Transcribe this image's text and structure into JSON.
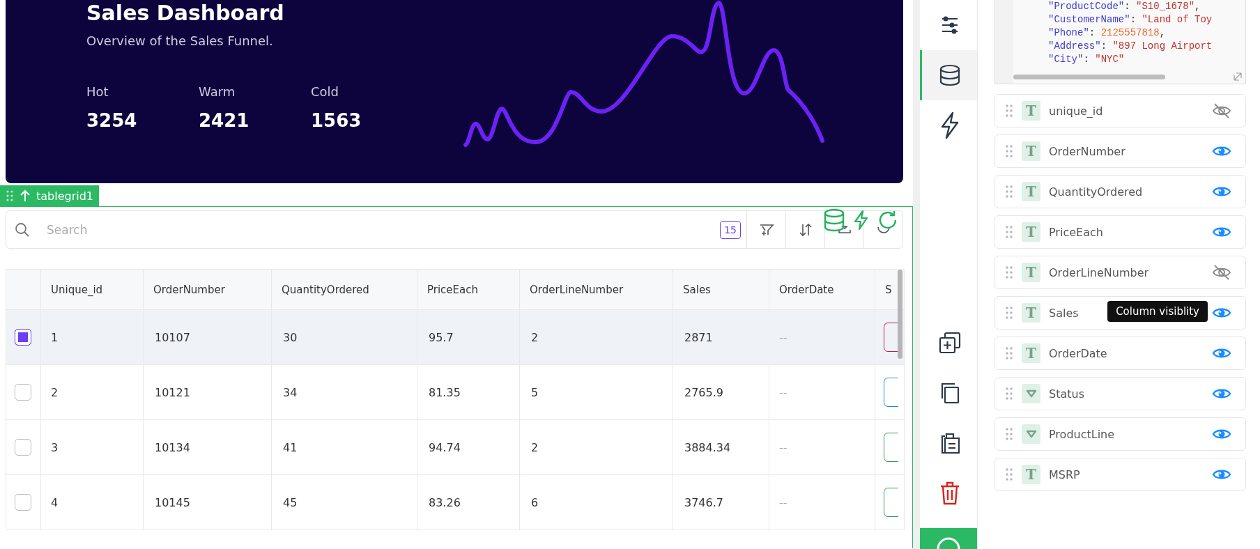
{
  "dashboard": {
    "title": "Sales Dashboard",
    "subtitle": "Overview of the Sales Funnel.",
    "stats": [
      {
        "label": "Hot",
        "value": "3254"
      },
      {
        "label": "Warm",
        "value": "2421"
      },
      {
        "label": "Cold",
        "value": "1563"
      }
    ]
  },
  "widget_tag": {
    "label": "tablegrid1"
  },
  "toolbar": {
    "search": {
      "placeholder": "Search"
    },
    "page_size": "15"
  },
  "table": {
    "columns": [
      "Unique_id",
      "OrderNumber",
      "QuantityOrdered",
      "PriceEach",
      "OrderLineNumber",
      "Sales",
      "OrderDate",
      "S"
    ],
    "rows": [
      {
        "selected": true,
        "cells": [
          "1",
          "10107",
          "30",
          "95.7",
          "2",
          "2871",
          "--"
        ],
        "color": "#c2185b"
      },
      {
        "selected": false,
        "cells": [
          "2",
          "10121",
          "34",
          "81.35",
          "5",
          "2765.9",
          "--"
        ],
        "color": "#1e88e5"
      },
      {
        "selected": false,
        "cells": [
          "3",
          "10134",
          "41",
          "94.74",
          "2",
          "3884.34",
          "--"
        ],
        "color": "#2e9e4f"
      },
      {
        "selected": false,
        "cells": [
          "4",
          "10145",
          "45",
          "83.26",
          "6",
          "3746.7",
          "--"
        ],
        "color": "#2e9e4f"
      }
    ]
  },
  "rail": [
    {
      "kind": "sliders",
      "selected": false
    },
    {
      "kind": "database",
      "selected": true
    },
    {
      "kind": "bolt",
      "selected": false
    },
    {
      "kind": "add-copy",
      "selected": false
    },
    {
      "kind": "copy",
      "selected": false
    },
    {
      "kind": "clipboard",
      "selected": false
    },
    {
      "kind": "trash",
      "selected": false
    }
  ],
  "code_lines": [
    [
      {
        "kind": "key",
        "text": "\"ProductCode\""
      },
      {
        "kind": "punct",
        "text": ": "
      },
      {
        "kind": "string",
        "text": "\"S10_1678\""
      },
      {
        "kind": "punct",
        "text": ","
      }
    ],
    [
      {
        "kind": "key",
        "text": "\"CustomerName\""
      },
      {
        "kind": "punct",
        "text": ": "
      },
      {
        "kind": "string",
        "text": "\"Land of Toy"
      }
    ],
    [
      {
        "kind": "key",
        "text": "\"Phone\""
      },
      {
        "kind": "punct",
        "text": ": "
      },
      {
        "kind": "number",
        "text": "2125557818"
      },
      {
        "kind": "punct",
        "text": ","
      }
    ],
    [
      {
        "kind": "key",
        "text": "\"Address\""
      },
      {
        "kind": "punct",
        "text": ": "
      },
      {
        "kind": "string",
        "text": "\"897 Long Airport"
      }
    ],
    [
      {
        "kind": "key",
        "text": "\"City\""
      },
      {
        "kind": "punct",
        "text": ": "
      },
      {
        "kind": "string",
        "text": "\"NYC\""
      }
    ]
  ],
  "fields": [
    {
      "name": "unique_id",
      "kind": "text",
      "type_glyph": "T",
      "visible": false
    },
    {
      "name": "OrderNumber",
      "kind": "text",
      "type_glyph": "T",
      "visible": true
    },
    {
      "name": "QuantityOrdered",
      "kind": "text",
      "type_glyph": "T",
      "visible": true
    },
    {
      "name": "PriceEach",
      "kind": "text",
      "type_glyph": "T",
      "visible": true
    },
    {
      "name": "OrderLineNumber",
      "kind": "text",
      "type_glyph": "T",
      "visible": false
    },
    {
      "name": "Sales",
      "kind": "text",
      "type_glyph": "T",
      "visible": true,
      "tooltip": "Column visiblity"
    },
    {
      "name": "OrderDate",
      "kind": "text",
      "type_glyph": "T",
      "visible": true
    },
    {
      "name": "Status",
      "kind": "dropdown",
      "visible": true
    },
    {
      "name": "ProductLine",
      "kind": "dropdown",
      "visible": true
    },
    {
      "name": "MSRP",
      "kind": "text",
      "type_glyph": "T",
      "visible": true
    }
  ]
}
